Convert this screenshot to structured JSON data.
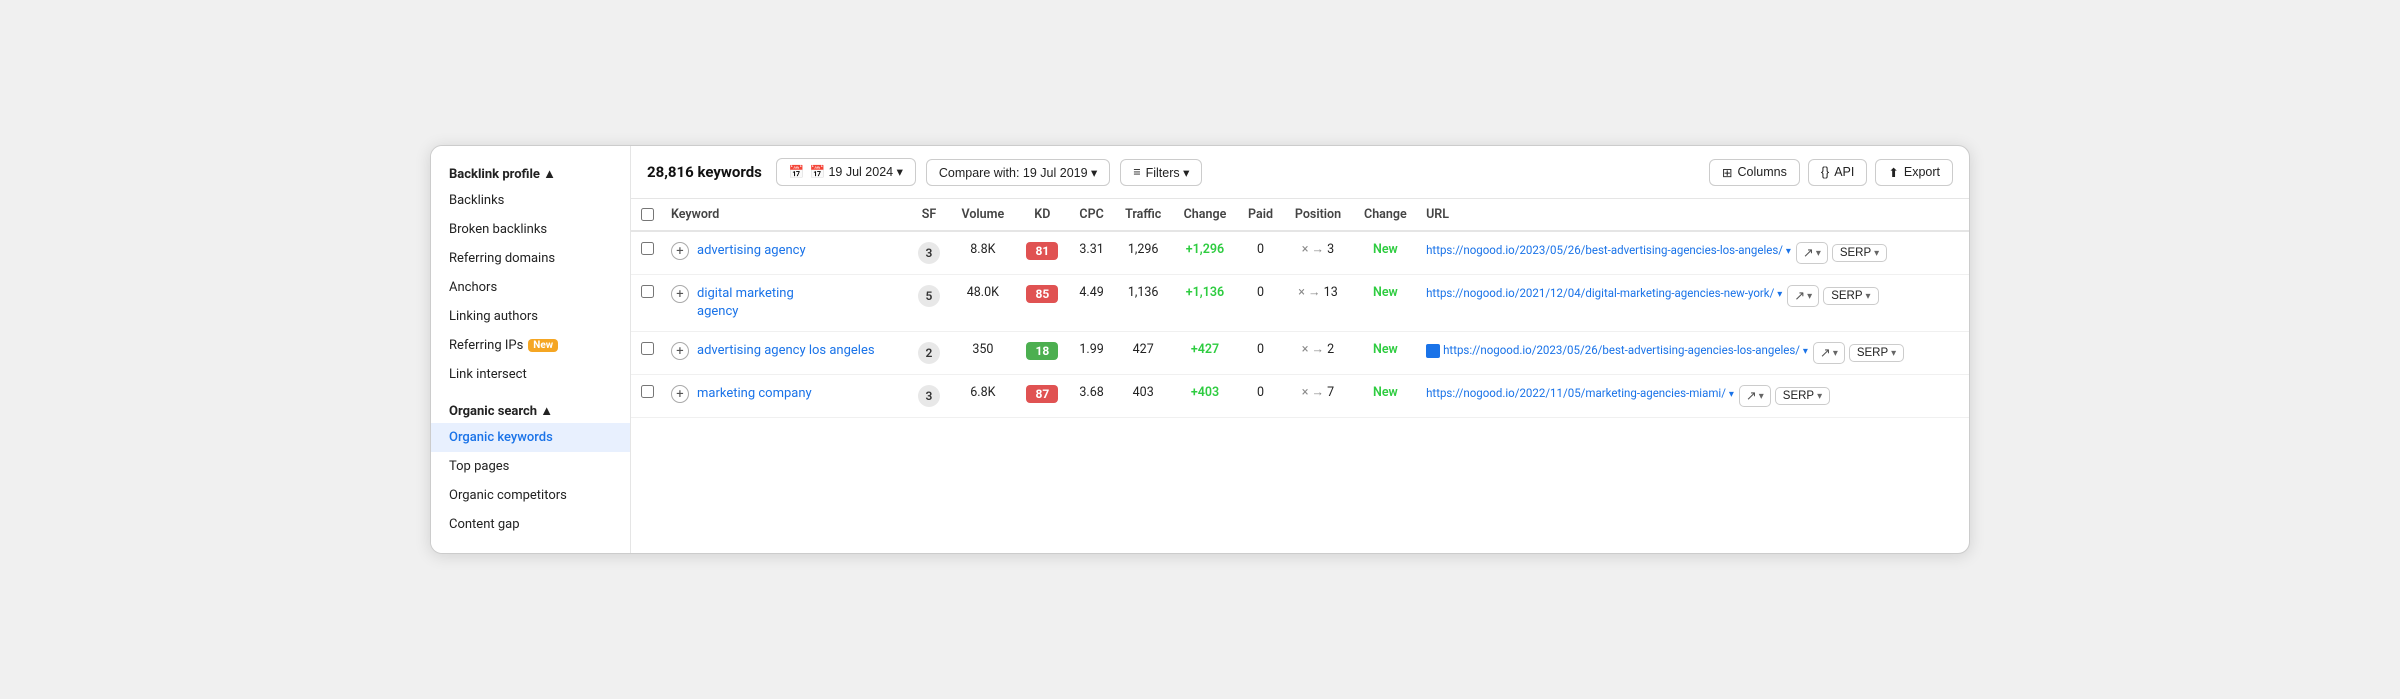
{
  "sidebar": {
    "backlink_profile_label": "Backlink profile ▲",
    "items_backlink": [
      {
        "id": "backlinks",
        "label": "Backlinks",
        "active": false
      },
      {
        "id": "broken-backlinks",
        "label": "Broken backlinks",
        "active": false
      },
      {
        "id": "referring-domains",
        "label": "Referring domains",
        "active": false
      },
      {
        "id": "anchors",
        "label": "Anchors",
        "active": false
      },
      {
        "id": "linking-authors",
        "label": "Linking authors",
        "active": false
      },
      {
        "id": "referring-ips",
        "label": "Referring IPs",
        "badge": "New",
        "active": false
      },
      {
        "id": "link-intersect",
        "label": "Link intersect",
        "active": false
      }
    ],
    "organic_search_label": "Organic search ▲",
    "items_organic": [
      {
        "id": "organic-keywords",
        "label": "Organic keywords",
        "active": true
      },
      {
        "id": "top-pages",
        "label": "Top pages",
        "active": false
      },
      {
        "id": "organic-competitors",
        "label": "Organic competitors",
        "active": false
      },
      {
        "id": "content-gap",
        "label": "Content gap",
        "active": false
      }
    ]
  },
  "toolbar": {
    "keywords_count": "28,816 keywords",
    "date_label": "📅 19 Jul 2024 ▾",
    "compare_label": "Compare with: 19 Jul 2019 ▾",
    "filters_label": "≡ Filters ▾",
    "columns_label": "Columns",
    "api_label": "API",
    "export_label": "Export"
  },
  "table": {
    "headers": [
      {
        "id": "checkbox",
        "label": ""
      },
      {
        "id": "keyword",
        "label": "Keyword"
      },
      {
        "id": "sf",
        "label": "SF"
      },
      {
        "id": "volume",
        "label": "Volume"
      },
      {
        "id": "kd",
        "label": "KD"
      },
      {
        "id": "cpc",
        "label": "CPC"
      },
      {
        "id": "traffic",
        "label": "Traffic"
      },
      {
        "id": "change",
        "label": "Change"
      },
      {
        "id": "paid",
        "label": "Paid"
      },
      {
        "id": "position",
        "label": "Position"
      },
      {
        "id": "pos-change",
        "label": "Change"
      },
      {
        "id": "url",
        "label": "URL"
      }
    ],
    "rows": [
      {
        "keyword": "advertising agency",
        "sf": "3",
        "volume": "8.8K",
        "kd": "81",
        "kd_color": "red",
        "cpc": "3.31",
        "traffic": "1,296",
        "change": "+1,296",
        "paid": "0",
        "position_arrow": "×  →",
        "position": "3",
        "pos_change": "New",
        "url": "https://nogood.io/2023/05/26/best-advertising-agencies-los-angeles/",
        "url_arrow": "▾"
      },
      {
        "keyword": "digital marketing\nagency",
        "sf": "5",
        "volume": "48.0K",
        "kd": "85",
        "kd_color": "red",
        "cpc": "4.49",
        "traffic": "1,136",
        "change": "+1,136",
        "paid": "0",
        "position_arrow": "×  →",
        "position": "13",
        "pos_change": "New",
        "url": "https://nogood.io/2021/12/04/digital-marketing-agencies-new-york/",
        "url_arrow": "▾"
      },
      {
        "keyword": "advertising agency los angeles",
        "sf": "2",
        "volume": "350",
        "kd": "18",
        "kd_color": "green",
        "cpc": "1.99",
        "traffic": "427",
        "change": "+427",
        "paid": "0",
        "position_arrow": "×  →",
        "position": "2",
        "pos_change": "New",
        "url": "https://nogood.io/2023/05/26/best-advertising-agencies-los-angeles/",
        "url_arrow": "▾",
        "has_favicon": true
      },
      {
        "keyword": "marketing company",
        "sf": "3",
        "volume": "6.8K",
        "kd": "87",
        "kd_color": "red",
        "cpc": "3.68",
        "traffic": "403",
        "change": "+403",
        "paid": "0",
        "position_arrow": "×  →",
        "position": "7",
        "pos_change": "New",
        "url": "https://nogood.io/2022/11/05/marketing-agencies-miami/",
        "url_arrow": "▾"
      }
    ]
  }
}
